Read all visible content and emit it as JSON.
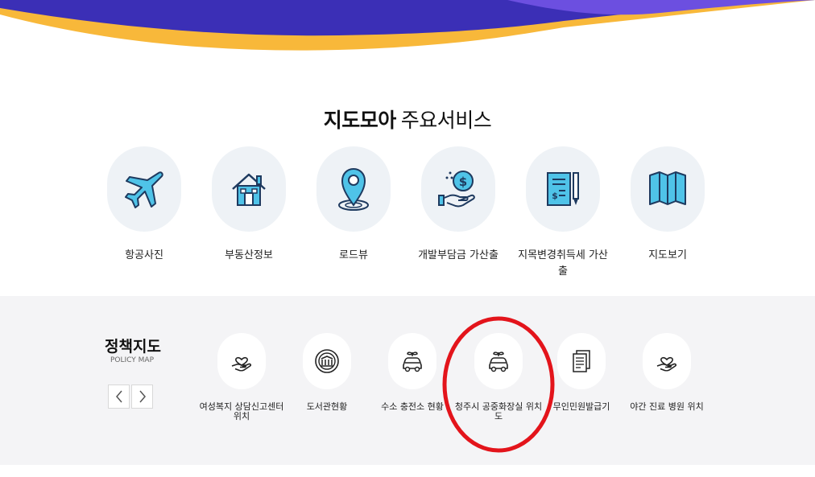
{
  "hero": {
    "colors": {
      "navy": "#3b2fb6",
      "purple": "#6c4fe0",
      "yellow": "#f8b83a"
    }
  },
  "main_services": {
    "title_bold": "지도모아",
    "title_light": "주요서비스",
    "items": [
      {
        "label": "항공사진",
        "icon": "airplane-icon"
      },
      {
        "label": "부동산정보",
        "icon": "house-icon"
      },
      {
        "label": "로드뷰",
        "icon": "location-pin-icon"
      },
      {
        "label": "개발부담금 가산출",
        "icon": "coin-hand-icon"
      },
      {
        "label": "지목변경취득세 가산출",
        "icon": "document-pen-icon"
      },
      {
        "label": "지도보기",
        "icon": "folded-map-icon"
      }
    ],
    "colors": {
      "icon_fill": "#4fc3e8",
      "icon_stroke": "#1e3a5f",
      "circle_bg": "#eef2f6"
    }
  },
  "policy_map": {
    "title": "정책지도",
    "subtitle": "POLICY MAP",
    "prev_label": "‹",
    "next_label": "›",
    "items": [
      {
        "label": "여성복지 상담신고센터 위치",
        "icon": "hand-heart-icon"
      },
      {
        "label": "도서관현황",
        "icon": "library-badge-icon"
      },
      {
        "label": "수소 충전소 현황",
        "icon": "eco-car-icon"
      },
      {
        "label": "청주시 공중화장실 위치도",
        "icon": "eco-car-icon"
      },
      {
        "label": "무인민원발급기",
        "icon": "documents-icon"
      },
      {
        "label": "야간 진료 병원 위치",
        "icon": "hand-heart-icon"
      }
    ],
    "highlight_color": "#e3141b"
  }
}
